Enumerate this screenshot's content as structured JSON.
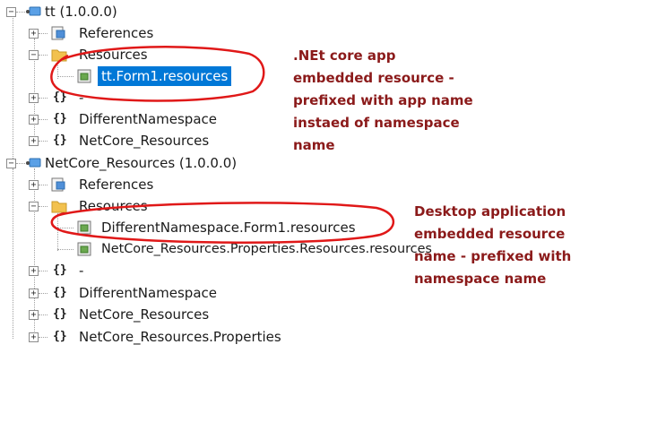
{
  "tree": {
    "project_tt": "tt (1.0.0.0)",
    "tt_references": "References",
    "tt_resources": "Resources",
    "tt_resource_file": "tt.Form1.resources",
    "tt_ns_empty": "-",
    "tt_ns_different": "DifferentNamespace",
    "tt_ns_netcore": "NetCore_Resources",
    "project_netcore": "NetCore_Resources (1.0.0.0)",
    "nc_references": "References",
    "nc_resources": "Resources",
    "nc_resource_file_1": "DifferentNamespace.Form1.resources",
    "nc_resource_file_2": "NetCore_Resources.Properties.Resources.resources",
    "nc_ns_empty": "-",
    "nc_ns_different": "DifferentNamespace",
    "nc_ns_netcore": "NetCore_Resources",
    "nc_ns_properties": "NetCore_Resources.Properties"
  },
  "annotations": {
    "netcore_note": [
      ".NEt core app",
      "embedded resource -",
      "prefixed with app name",
      "instaed of namespace",
      "name"
    ],
    "desktop_note": [
      "Desktop application",
      "embedded resource",
      "name - prefixed with",
      "namespace name"
    ]
  },
  "colors": {
    "selection": "#0078d7",
    "annotation_text": "#8b1a1a",
    "annotation_ellipse": "#e01818"
  }
}
